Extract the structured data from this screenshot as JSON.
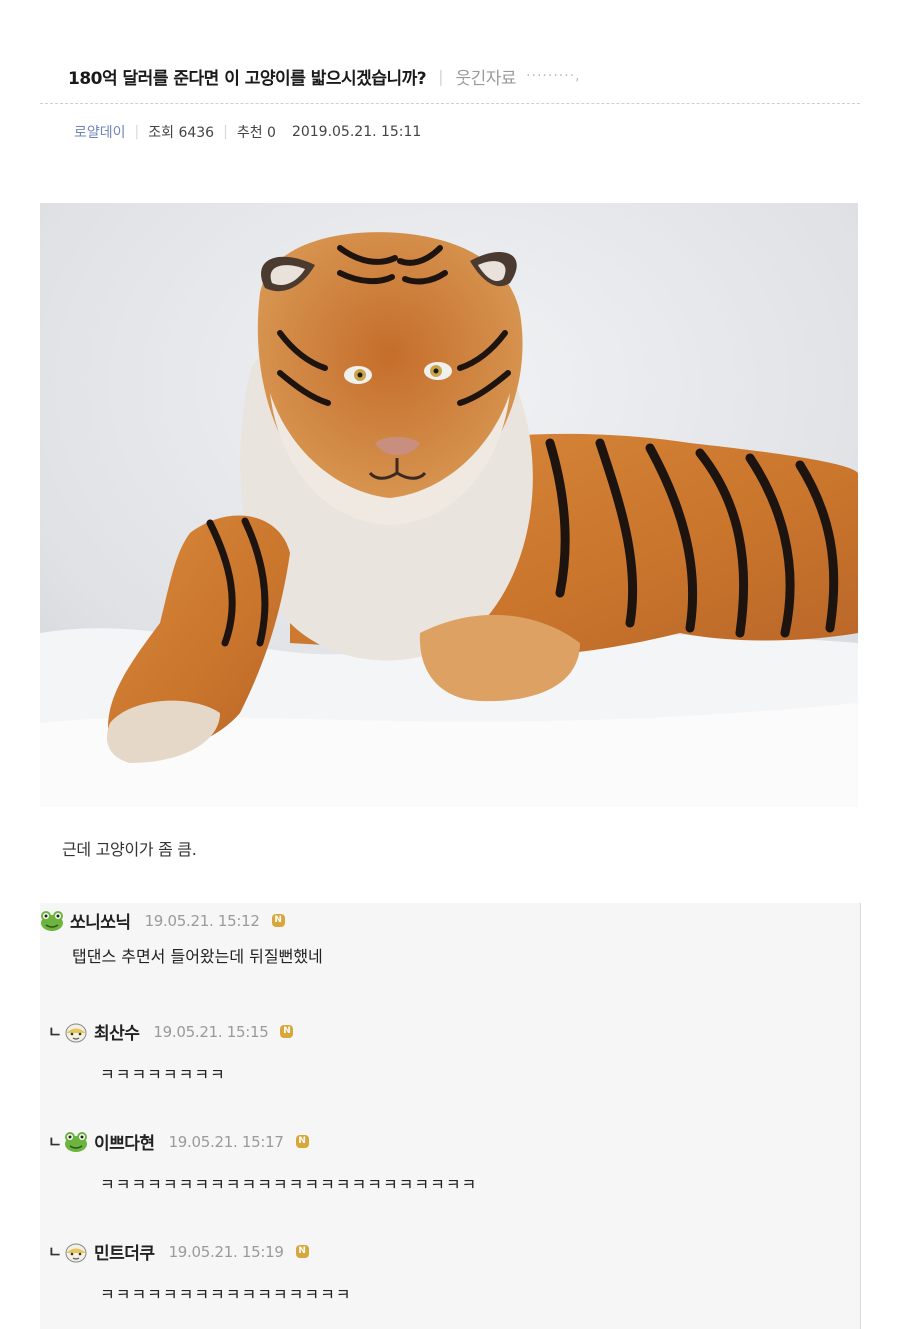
{
  "post": {
    "title": "180억 달러를 준다면 이 고양이를 밟으시겠습니까?",
    "category": "웃긴자료",
    "dots": "·········,",
    "author": "로얄데이",
    "views": "조회 6436",
    "recommend": "추천 0",
    "datetime": "2019.05.21. 15:11",
    "photo_icon": "tiger-photo",
    "body": "근데 고양이가 좀 큼."
  },
  "colors": {
    "author_link": "#6f86b8",
    "badge": "#d9a63b",
    "comment_bg": "#f6f6f6"
  },
  "comments": [
    {
      "name": "쏘니쏘닉",
      "date": "19.05.21. 15:12",
      "badge": "N",
      "avatar_icon": "frog-icon",
      "reply": false,
      "text": "탭댄스 추면서 들어왔는데 뒤질뻔했네"
    },
    {
      "name": "최산수",
      "date": "19.05.21. 15:15",
      "badge": "N",
      "avatar_icon": "egg-face-icon",
      "reply": true,
      "reply_mark": "ㄴ",
      "text": "ㅋㅋㅋㅋㅋㅋㅋㅋ"
    },
    {
      "name": "이쁘다현",
      "date": "19.05.21. 15:17",
      "badge": "N",
      "avatar_icon": "frog-icon",
      "reply": true,
      "reply_mark": "ㄴ",
      "text": "ㅋㅋㅋㅋㅋㅋㅋㅋㅋㅋㅋㅋㅋㅋㅋㅋㅋㅋㅋㅋㅋㅋㅋㅋ"
    },
    {
      "name": "민트더쿠",
      "date": "19.05.21. 15:19",
      "badge": "N",
      "avatar_icon": "egg-face-icon",
      "reply": true,
      "reply_mark": "ㄴ",
      "text": "ㅋㅋㅋㅋㅋㅋㅋㅋㅋㅋㅋㅋㅋㅋㅋㅋ"
    }
  ]
}
